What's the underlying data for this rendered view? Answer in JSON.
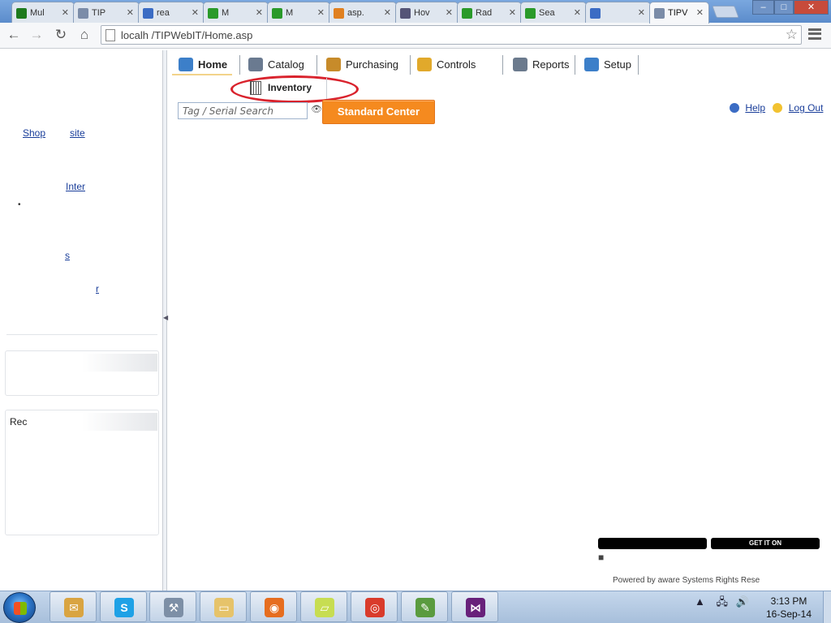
{
  "browser": {
    "tabs": [
      {
        "label": "Mul",
        "color": "#1e7a1e"
      },
      {
        "label": "TIP",
        "color": "#7b8ca8"
      },
      {
        "label": "rea",
        "color": "#3b6cc4"
      },
      {
        "label": "M",
        "color": "#2a9a2a"
      },
      {
        "label": "M",
        "color": "#2a9a2a"
      },
      {
        "label": "asp.",
        "color": "#e08020"
      },
      {
        "label": "Hov",
        "color": "#557"
      },
      {
        "label": "Rad",
        "color": "#2a9a2a"
      },
      {
        "label": "Sea",
        "color": "#2a9a2a"
      },
      {
        "label": "",
        "color": "#3b6cc4"
      },
      {
        "label": "TIPV",
        "color": "#7b8ca8"
      }
    ],
    "url": "localh    /TIPWebIT/Home.asp",
    "window_buttons": {
      "minimize": "–",
      "maximize": "□",
      "close": "✕"
    },
    "icons": [
      "back-icon",
      "forward-icon",
      "reload-icon",
      "home-icon",
      "star-icon",
      "menu-icon"
    ]
  },
  "app_nav": {
    "tabs": [
      {
        "label": "Home",
        "icon": "house-icon",
        "color": "#3c7fc9",
        "active": true
      },
      {
        "label": "Catalog",
        "icon": "book-icon",
        "color": "#6a7a90"
      },
      {
        "label": "Purchasing",
        "icon": "cart-icon",
        "color": "#c78b2a"
      },
      {
        "label": "Controls",
        "icon": "key-icon",
        "color": "#e1a92b"
      },
      {
        "label": "Reports",
        "icon": "report-icon",
        "color": "#6b7a8d"
      },
      {
        "label": "Setup",
        "icon": "gears-icon",
        "color": "#3c7fc9"
      }
    ],
    "subnav_label": "Inventory",
    "search_placeholder": "Tag / Serial Search",
    "action_button": "Standard Center",
    "top_right_links": [
      "Help",
      "Log Out"
    ]
  },
  "sidebar": {
    "links": [
      "Shop",
      "site",
      "Inter",
      "s",
      "",
      "r",
      ""
    ],
    "panel1_header": "",
    "panel2_header": "Rec"
  },
  "footer": {
    "badge_left": "",
    "badge_right": "GET IT ON",
    "text": "Powered by  aware Systems  Rights  Rese"
  },
  "taskbar": {
    "apps": [
      {
        "name": "outlook-icon",
        "color": "#d9a441",
        "glyph": "✉"
      },
      {
        "name": "skype-icon",
        "color": "#1ea1e6",
        "glyph": "S"
      },
      {
        "name": "tools-icon",
        "color": "#7d8fa6",
        "glyph": "⚒"
      },
      {
        "name": "explorer-icon",
        "color": "#e6c36a",
        "glyph": "▭"
      },
      {
        "name": "firefox-icon",
        "color": "#e66d1f",
        "glyph": "◉"
      },
      {
        "name": "sticky-notes-icon",
        "color": "#c7dd52",
        "glyph": "▱"
      },
      {
        "name": "chrome-icon",
        "color": "#d93b2b",
        "glyph": "◎"
      },
      {
        "name": "editor-icon",
        "color": "#5a9b3f",
        "glyph": "✎"
      },
      {
        "name": "visual-studio-icon",
        "color": "#68217a",
        "glyph": "⋈"
      }
    ],
    "time": "3:13 PM",
    "date": "16-Sep-14"
  }
}
